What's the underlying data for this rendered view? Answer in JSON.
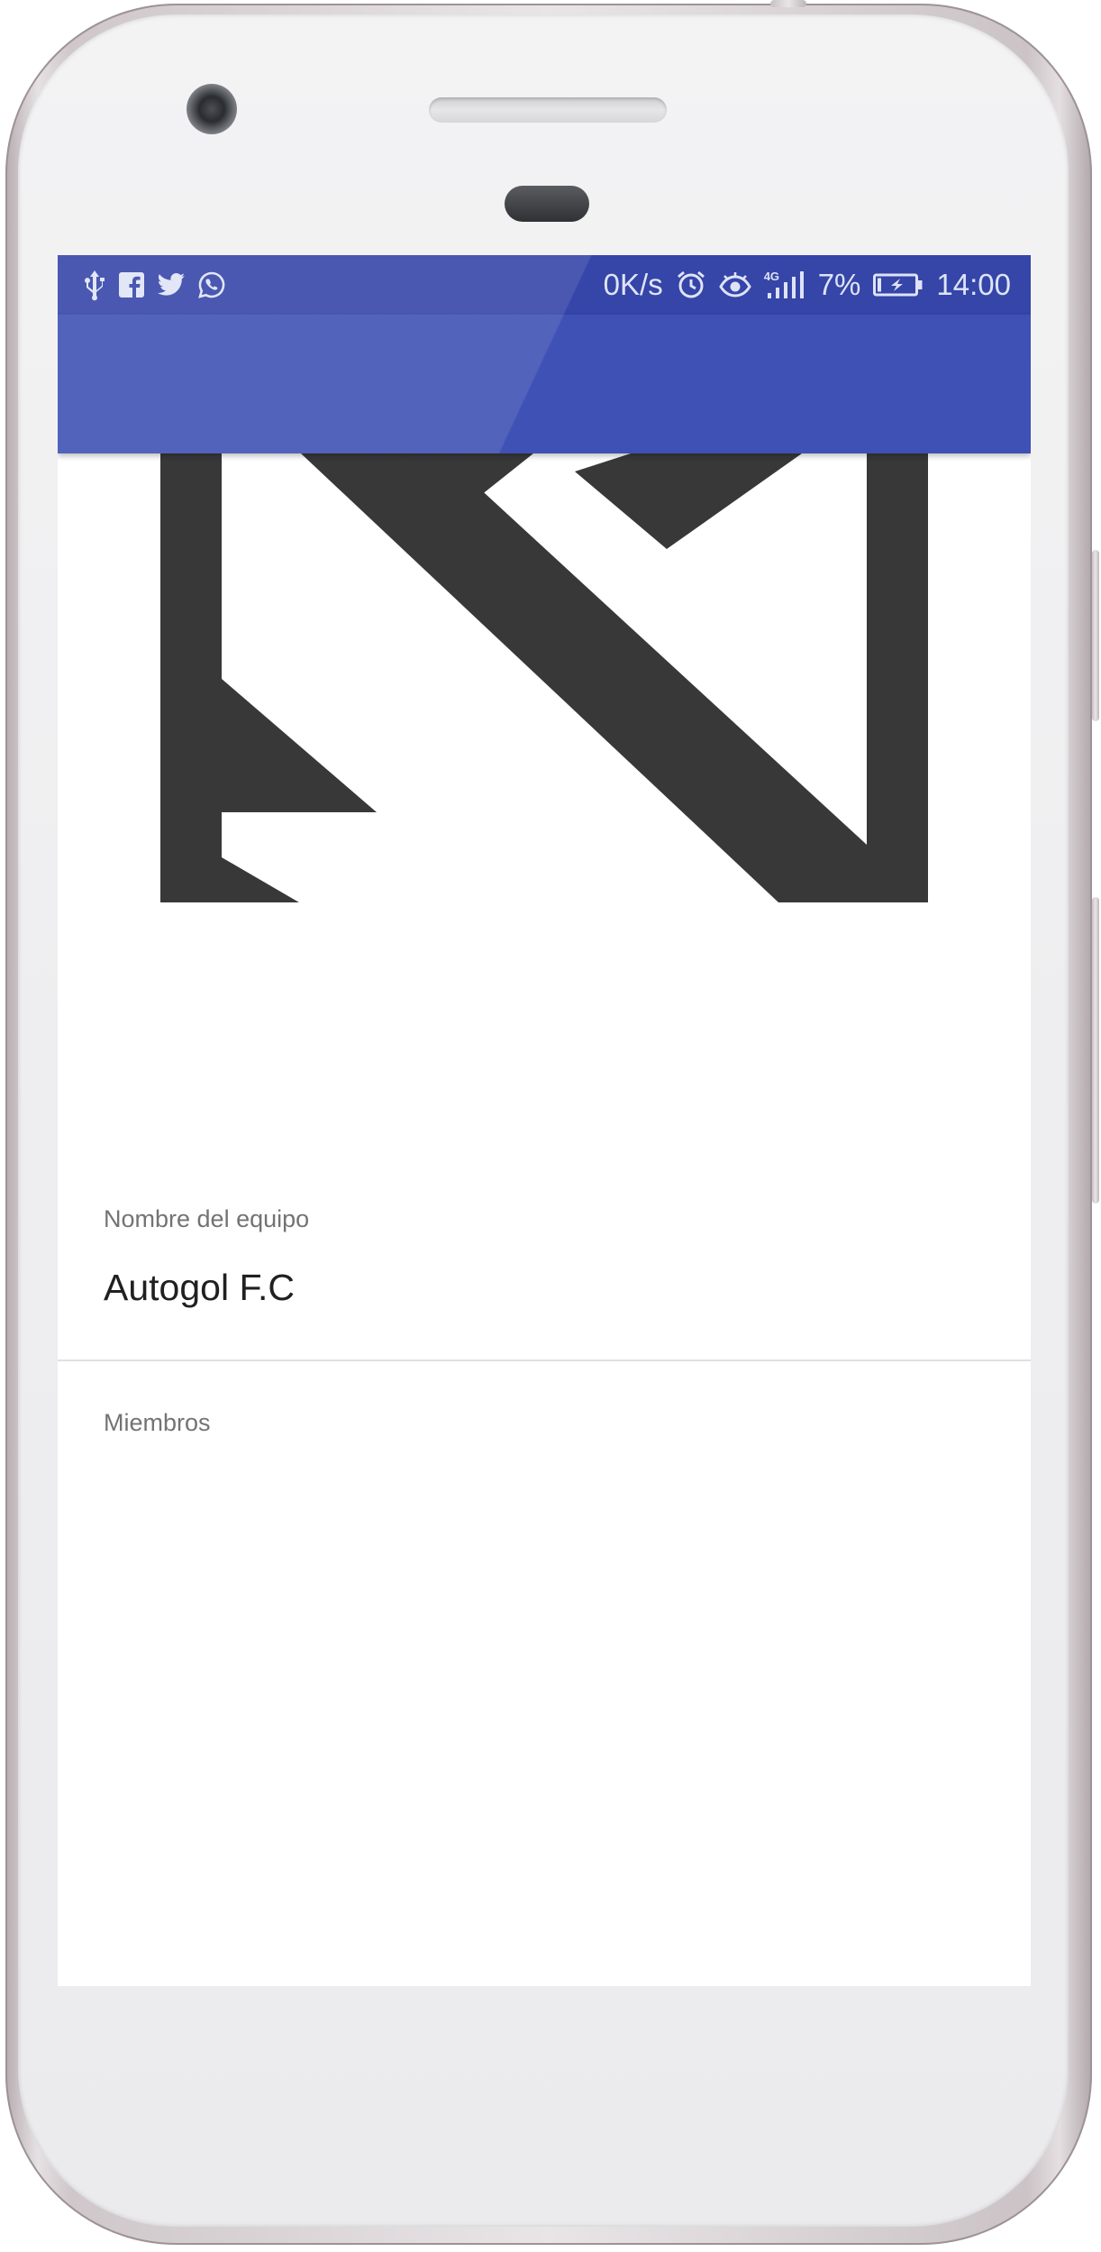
{
  "status_bar": {
    "net_speed": "0K/s",
    "network": "4G",
    "battery": "7%",
    "time": "14:00",
    "left_icons": [
      "usb-icon",
      "facebook-icon",
      "twitter-icon",
      "whatsapp-icon"
    ],
    "right_icons": [
      "alarm-icon",
      "eye-icon",
      "signal-icon",
      "battery-charging-icon"
    ]
  },
  "colors": {
    "status_bar": "#3545a8",
    "app_bar": "#3f51b5",
    "logo": "#383838"
  },
  "team": {
    "name_label": "Nombre del equipo",
    "name_value": "Autogol F.C",
    "members_label": "Miembros"
  }
}
